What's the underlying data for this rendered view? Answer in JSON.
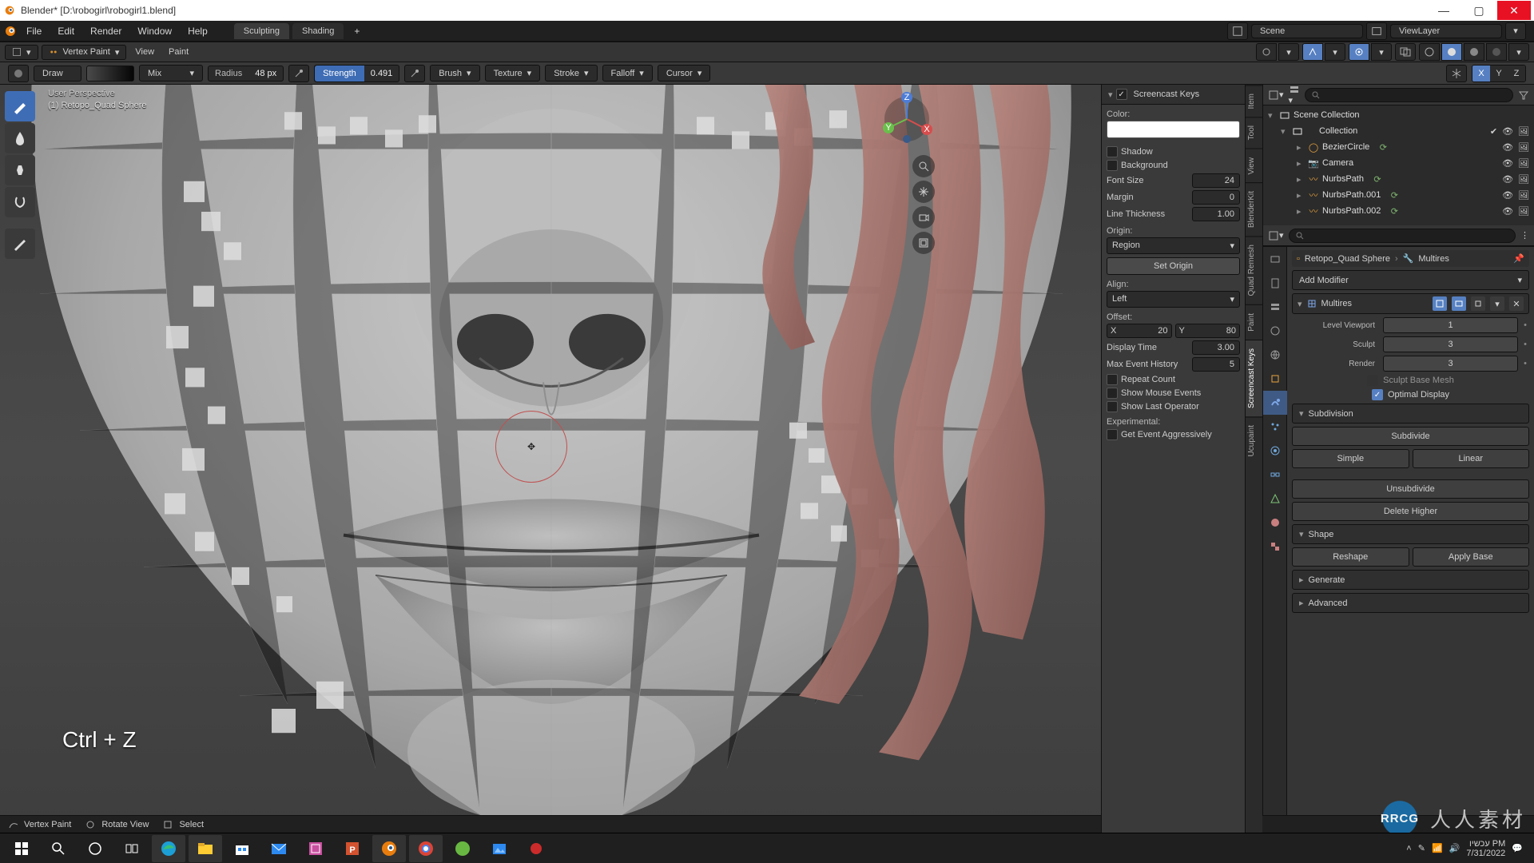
{
  "title": "Blender* [D:\\robogirl\\robogirl1.blend]",
  "menus": {
    "file": "File",
    "edit": "Edit",
    "render": "Render",
    "window": "Window",
    "help": "Help"
  },
  "workspaces": {
    "sculpting": "Sculpting",
    "shading": "Shading"
  },
  "scene_label": "Scene",
  "viewlayer_label": "ViewLayer",
  "hdr2": {
    "mode": "Vertex Paint",
    "view": "View",
    "paint": "Paint"
  },
  "hdr3": {
    "brush": "Draw",
    "mode": "Mix",
    "radius_label": "Radius",
    "radius_value": "48 px",
    "strength_label": "Strength",
    "strength_value": "0.491",
    "brush_menu": "Brush",
    "texture_menu": "Texture",
    "stroke_menu": "Stroke",
    "falloff_menu": "Falloff",
    "cursor_menu": "Cursor",
    "axis_x": "X",
    "axis_y": "Y",
    "axis_z": "Z"
  },
  "overlay": {
    "l1": "User Perspective",
    "l2": "(1) Retopo_Quad Sphere",
    "screencast": "Ctrl + Z"
  },
  "ntabs": [
    "Item",
    "Tool",
    "View",
    "BlenderKit",
    "Quad Remesh",
    "Paint",
    "Screencast Keys",
    "Ucupaint"
  ],
  "npanel": {
    "title": "Screencast Keys",
    "color": "Color:",
    "shadow": "Shadow",
    "background": "Background",
    "fontsize_lbl": "Font Size",
    "fontsize_val": "24",
    "margin_lbl": "Margin",
    "margin_val": "0",
    "linethick_lbl": "Line Thickness",
    "linethick_val": "1.00",
    "origin": "Origin:",
    "origin_val": "Region",
    "setorigin": "Set Origin",
    "align": "Align:",
    "align_val": "Left",
    "offset": "Offset:",
    "x": "X",
    "x_val": "20",
    "y": "Y",
    "y_val": "80",
    "disptime_lbl": "Display Time",
    "disptime_val": "3.00",
    "maxhist_lbl": "Max Event History",
    "maxhist_val": "5",
    "repeat": "Repeat Count",
    "mouse": "Show Mouse Events",
    "lastop": "Show Last Operator",
    "experimental": "Experimental:",
    "aggressive": "Get Event Aggressively"
  },
  "outliner": {
    "root": "Scene Collection",
    "coll": "Collection",
    "items": [
      "BezierCircle",
      "Camera",
      "NurbsPath",
      "NurbsPath.001",
      "NurbsPath.002"
    ]
  },
  "props": {
    "bc_obj": "Retopo_Quad Sphere",
    "bc_mod": "Multires",
    "addmod": "Add Modifier",
    "mod_name": "Multires",
    "lvlview": "Level Viewport",
    "lvlview_v": "1",
    "sculpt": "Sculpt",
    "sculpt_v": "3",
    "render": "Render",
    "render_v": "3",
    "sculptbase": "Sculpt Base Mesh",
    "optimal": "Optimal Display",
    "subdiv": "Subdivision",
    "subdivide": "Subdivide",
    "simple": "Simple",
    "linear": "Linear",
    "unsub": "Unsubdivide",
    "delhigher": "Delete Higher",
    "shape": "Shape",
    "reshape": "Reshape",
    "applybase": "Apply Base",
    "generate": "Generate",
    "advanced": "Advanced"
  },
  "statusbar": {
    "mode": "Vertex Paint",
    "rotate": "Rotate View",
    "select": "Select"
  },
  "watermark": {
    "logo": "RR",
    "text": "人人素材"
  },
  "taskbar": {
    "time": "עכשיו PM",
    "date": "7/31/2022"
  }
}
